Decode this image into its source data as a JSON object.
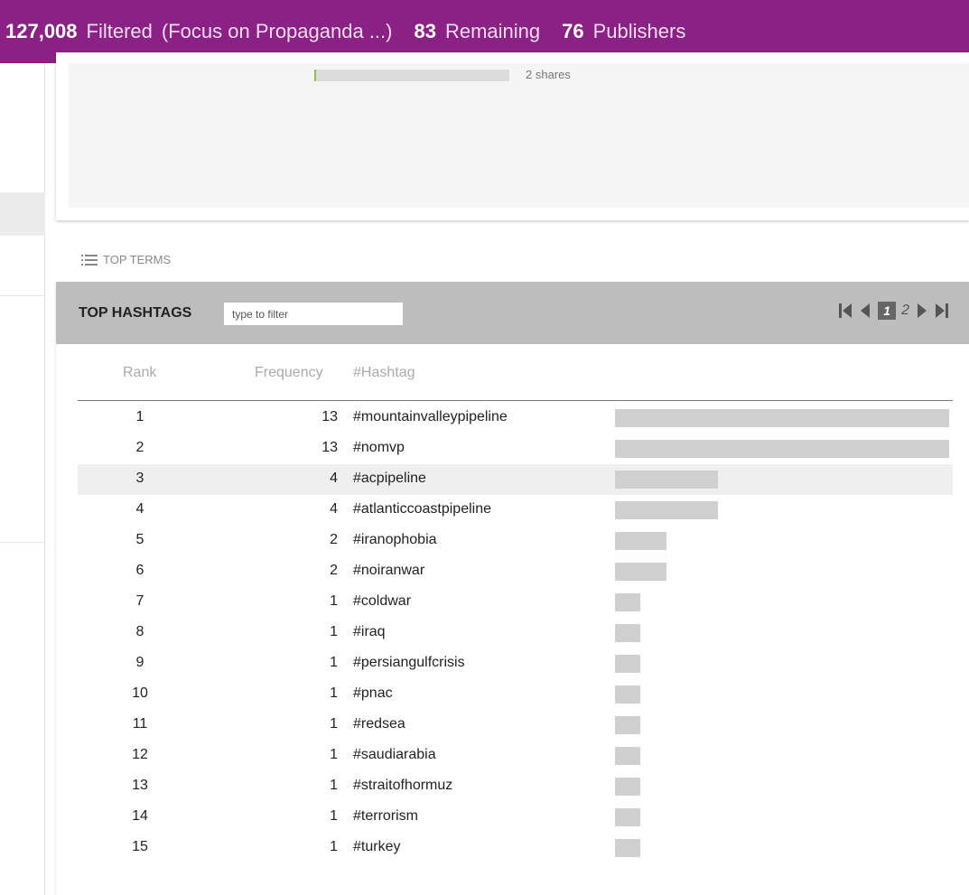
{
  "summary": {
    "filtered_count": "127,008",
    "filtered_label": "Filtered",
    "filter_name": "(Focus on Propaganda ...)",
    "remaining_count": "83",
    "remaining_label": "Remaining",
    "publishers_count": "76",
    "publishers_label": "Publishers"
  },
  "shares_card": {
    "shares_label": "2 shares",
    "shares_fraction": 0.01
  },
  "top_terms": {
    "heading": "TOP TERMS",
    "icon": "list-icon"
  },
  "hashtags": {
    "title": "TOP HASHTAGS",
    "filter_placeholder": "type to filter",
    "pager": {
      "current_page": "1",
      "next_page": "2"
    },
    "columns": {
      "rank": "Rank",
      "frequency": "Frequency",
      "hashtag": "#Hashtag"
    },
    "max_frequency": 13,
    "rows": [
      {
        "rank": "1",
        "frequency": "13",
        "hashtag": "#mountainvalleypipeline",
        "value": 13
      },
      {
        "rank": "2",
        "frequency": "13",
        "hashtag": "#nomvp",
        "value": 13
      },
      {
        "rank": "3",
        "frequency": "4",
        "hashtag": "#acpipeline",
        "value": 4
      },
      {
        "rank": "4",
        "frequency": "4",
        "hashtag": "#atlanticcoastpipeline",
        "value": 4
      },
      {
        "rank": "5",
        "frequency": "2",
        "hashtag": "#iranophobia",
        "value": 2
      },
      {
        "rank": "6",
        "frequency": "2",
        "hashtag": "#noiranwar",
        "value": 2
      },
      {
        "rank": "7",
        "frequency": "1",
        "hashtag": "#coldwar",
        "value": 1
      },
      {
        "rank": "8",
        "frequency": "1",
        "hashtag": "#iraq",
        "value": 1
      },
      {
        "rank": "9",
        "frequency": "1",
        "hashtag": "#persiangulfcrisis",
        "value": 1
      },
      {
        "rank": "10",
        "frequency": "1",
        "hashtag": "#pnac",
        "value": 1
      },
      {
        "rank": "11",
        "frequency": "1",
        "hashtag": "#redsea",
        "value": 1
      },
      {
        "rank": "12",
        "frequency": "1",
        "hashtag": "#saudiarabia",
        "value": 1
      },
      {
        "rank": "13",
        "frequency": "1",
        "hashtag": "#straitofhormuz",
        "value": 1
      },
      {
        "rank": "14",
        "frequency": "1",
        "hashtag": "#terrorism",
        "value": 1
      },
      {
        "rank": "15",
        "frequency": "1",
        "hashtag": "#turkey",
        "value": 1
      }
    ]
  }
}
